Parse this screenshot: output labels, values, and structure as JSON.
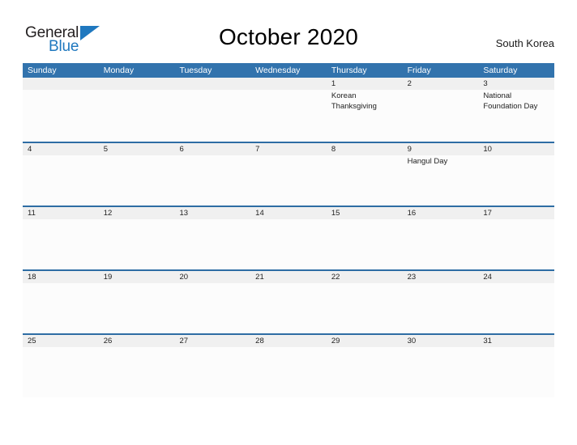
{
  "brand": {
    "logo_word1": "General",
    "logo_word2": "Blue",
    "logo_icon": "triangle-icon",
    "accent_color": "#1f78bf"
  },
  "header": {
    "title": "October 2020",
    "country": "South Korea"
  },
  "colors": {
    "header_blue": "#3273ad",
    "row_divider_blue": "#2e6da4",
    "date_band_gray": "#f0f0f0",
    "cell_background": "#fcfcfc",
    "text": "#222222"
  },
  "calendar": {
    "month": "October",
    "year": "2020",
    "weekdays": [
      "Sunday",
      "Monday",
      "Tuesday",
      "Wednesday",
      "Thursday",
      "Friday",
      "Saturday"
    ],
    "weeks": [
      {
        "days": [
          {
            "date": "",
            "event": ""
          },
          {
            "date": "",
            "event": ""
          },
          {
            "date": "",
            "event": ""
          },
          {
            "date": "",
            "event": ""
          },
          {
            "date": "1",
            "event": "Korean Thanksgiving"
          },
          {
            "date": "2",
            "event": ""
          },
          {
            "date": "3",
            "event": "National Foundation Day"
          }
        ]
      },
      {
        "days": [
          {
            "date": "4",
            "event": ""
          },
          {
            "date": "5",
            "event": ""
          },
          {
            "date": "6",
            "event": ""
          },
          {
            "date": "7",
            "event": ""
          },
          {
            "date": "8",
            "event": ""
          },
          {
            "date": "9",
            "event": "Hangul Day"
          },
          {
            "date": "10",
            "event": ""
          }
        ]
      },
      {
        "days": [
          {
            "date": "11",
            "event": ""
          },
          {
            "date": "12",
            "event": ""
          },
          {
            "date": "13",
            "event": ""
          },
          {
            "date": "14",
            "event": ""
          },
          {
            "date": "15",
            "event": ""
          },
          {
            "date": "16",
            "event": ""
          },
          {
            "date": "17",
            "event": ""
          }
        ]
      },
      {
        "days": [
          {
            "date": "18",
            "event": ""
          },
          {
            "date": "19",
            "event": ""
          },
          {
            "date": "20",
            "event": ""
          },
          {
            "date": "21",
            "event": ""
          },
          {
            "date": "22",
            "event": ""
          },
          {
            "date": "23",
            "event": ""
          },
          {
            "date": "24",
            "event": ""
          }
        ]
      },
      {
        "days": [
          {
            "date": "25",
            "event": ""
          },
          {
            "date": "26",
            "event": ""
          },
          {
            "date": "27",
            "event": ""
          },
          {
            "date": "28",
            "event": ""
          },
          {
            "date": "29",
            "event": ""
          },
          {
            "date": "30",
            "event": ""
          },
          {
            "date": "31",
            "event": ""
          }
        ]
      }
    ]
  }
}
